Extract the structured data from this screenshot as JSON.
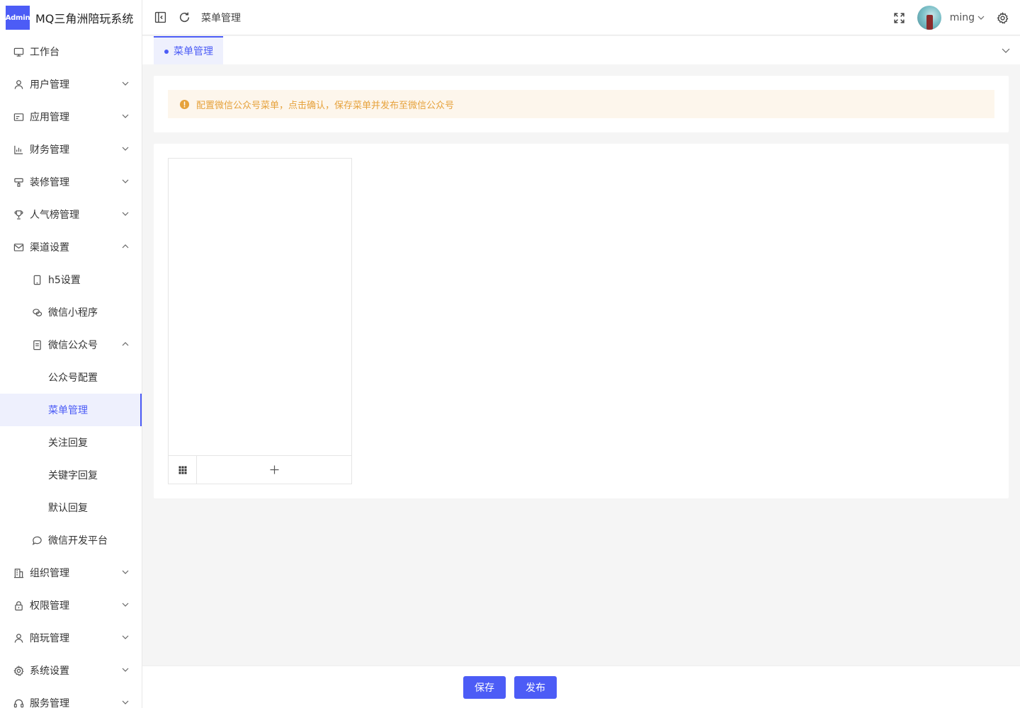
{
  "brand": {
    "logo_text": "Admin",
    "title": "MQ三角洲陪玩系统"
  },
  "header": {
    "breadcrumb": "菜单管理",
    "username": "ming"
  },
  "sidebar": {
    "items": [
      {
        "label": "工作台",
        "icon": "monitor-icon"
      },
      {
        "label": "用户管理",
        "icon": "user-icon",
        "expanded": false
      },
      {
        "label": "应用管理",
        "icon": "card-icon",
        "expanded": false
      },
      {
        "label": "财务管理",
        "icon": "chart-icon",
        "expanded": false
      },
      {
        "label": "装修管理",
        "icon": "brush-icon",
        "expanded": false
      },
      {
        "label": "人气榜管理",
        "icon": "trophy-icon",
        "expanded": false
      },
      {
        "label": "渠道设置",
        "icon": "mail-icon",
        "expanded": true
      },
      {
        "label": "h5设置",
        "icon": "phone-icon"
      },
      {
        "label": "微信小程序",
        "icon": "wechat-icon"
      },
      {
        "label": "微信公众号",
        "icon": "document-icon",
        "expanded": true
      },
      {
        "label": "公众号配置"
      },
      {
        "label": "菜单管理",
        "active": true
      },
      {
        "label": "关注回复"
      },
      {
        "label": "关键字回复"
      },
      {
        "label": "默认回复"
      },
      {
        "label": "微信开发平台",
        "icon": "chat-icon"
      },
      {
        "label": "组织管理",
        "icon": "building-icon",
        "expanded": false
      },
      {
        "label": "权限管理",
        "icon": "lock-icon",
        "expanded": false
      },
      {
        "label": "陪玩管理",
        "icon": "user-icon",
        "expanded": false
      },
      {
        "label": "系统设置",
        "icon": "gear-icon",
        "expanded": false
      },
      {
        "label": "服务管理",
        "icon": "headset-icon",
        "expanded": false
      }
    ]
  },
  "tabs": [
    {
      "label": "菜单管理",
      "active": true
    }
  ],
  "alert": {
    "text": "配置微信公众号菜单，点击确认，保存菜单并发布至微信公众号",
    "color": "#e6a23c"
  },
  "footer": {
    "save_label": "保存",
    "publish_label": "发布"
  },
  "theme": {
    "accent": "#4c5cf6",
    "alert_bg": "#fdf6ec"
  }
}
